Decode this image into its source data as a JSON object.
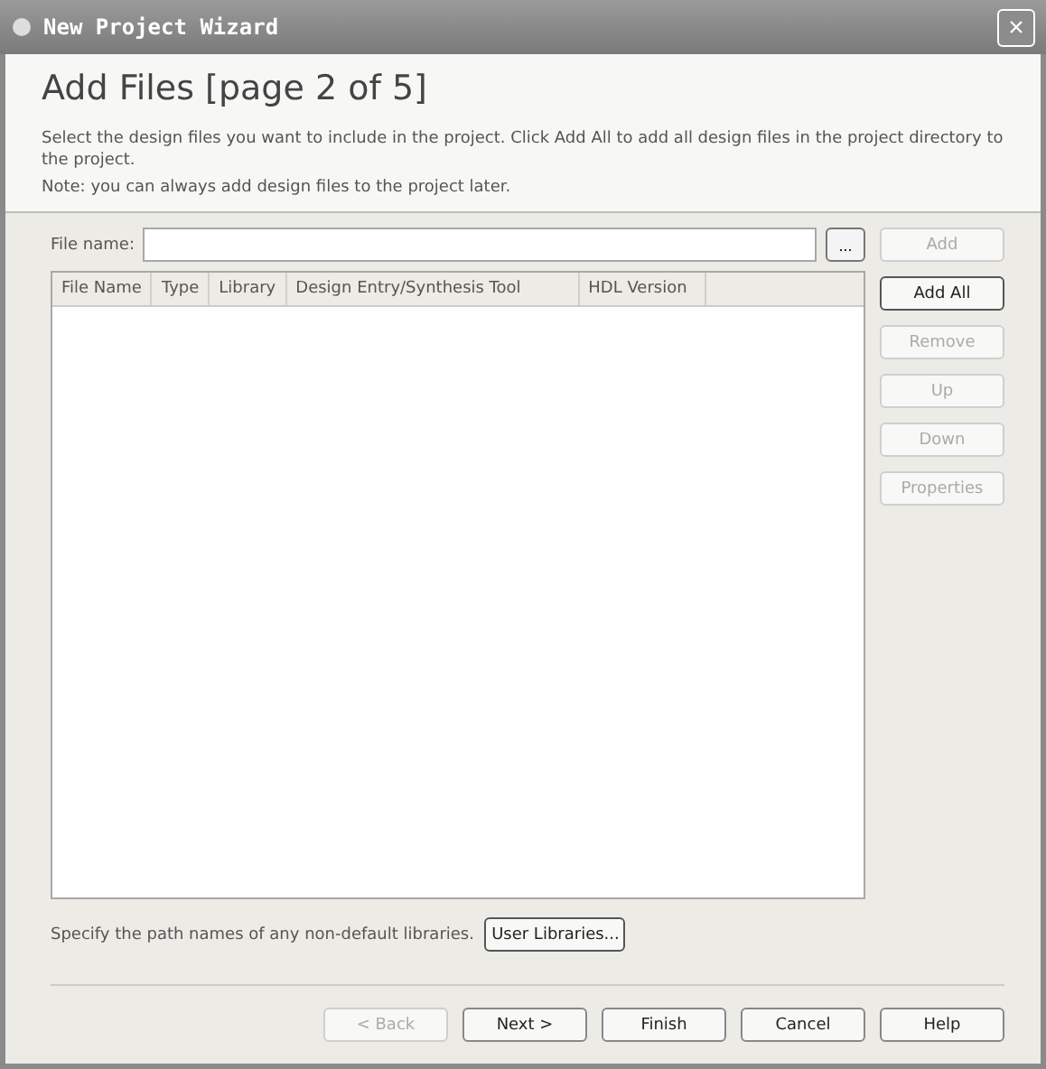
{
  "window": {
    "title": "New Project Wizard",
    "close": "×"
  },
  "header": {
    "title": "Add Files [page 2 of 5]",
    "description": "Select the design files you want to include in the project. Click Add All to add all design files in the project directory to the project.",
    "note": "Note: you can always add design files to the project later."
  },
  "file_name": {
    "label": "File name:",
    "browse": "..."
  },
  "table": {
    "columns": [
      "File Name",
      "Type",
      "Library",
      "Design Entry/Synthesis Tool",
      "HDL Version"
    ]
  },
  "side_buttons": [
    {
      "label": "Add",
      "disabled": true,
      "focused": false
    },
    {
      "label": "Add All",
      "disabled": false,
      "focused": true
    },
    {
      "label": "Remove",
      "disabled": true,
      "focused": false
    },
    {
      "label": "Up",
      "disabled": true,
      "focused": false
    },
    {
      "label": "Down",
      "disabled": true,
      "focused": false
    },
    {
      "label": "Properties",
      "disabled": true,
      "focused": false
    }
  ],
  "libraries": {
    "text": "Specify the path names of any non-default libraries.",
    "button": "User Libraries..."
  },
  "buttons": [
    {
      "label": "< Back",
      "disabled": true
    },
    {
      "label": "Next >",
      "disabled": false
    },
    {
      "label": "Finish",
      "disabled": false
    },
    {
      "label": "Cancel",
      "disabled": false
    },
    {
      "label": "Help",
      "disabled": false
    }
  ]
}
